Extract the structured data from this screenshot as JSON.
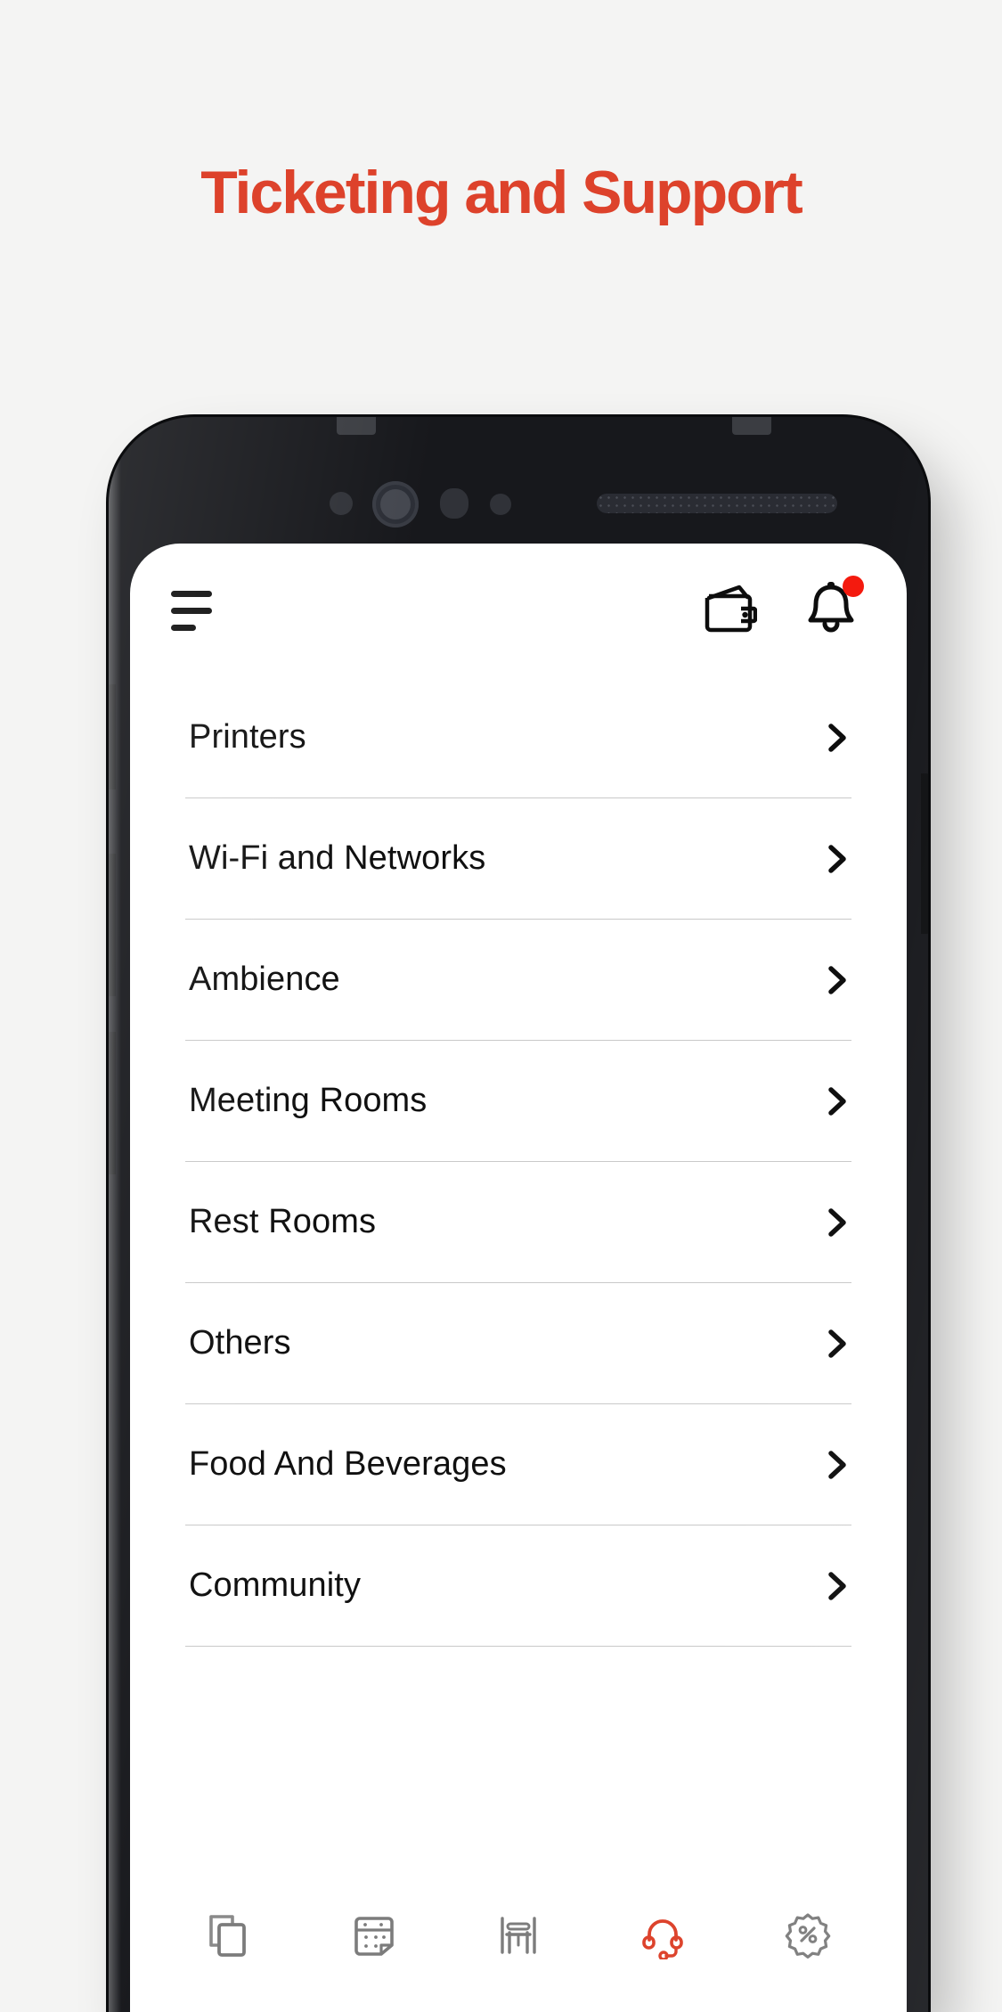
{
  "page": {
    "title": "Ticketing and Support",
    "title_color": "#dd422b",
    "background_color": "#f4f4f3"
  },
  "app": {
    "header": {
      "menu_icon": "hamburger-menu-icon",
      "wallet_icon": "wallet-icon",
      "notifications_icon": "bell-icon",
      "notification_badge_color": "#f41a0e",
      "has_notification": true
    },
    "list": {
      "chevron_icon": "chevron-right-icon",
      "items": [
        {
          "label": "Printers"
        },
        {
          "label": "Wi-Fi and Networks"
        },
        {
          "label": "Ambience"
        },
        {
          "label": "Meeting Rooms"
        },
        {
          "label": "Rest Rooms"
        },
        {
          "label": "Others"
        },
        {
          "label": "Food And Beverages"
        },
        {
          "label": "Community"
        }
      ]
    },
    "bottom_nav": {
      "active_color": "#dd422b",
      "inactive_color": "#7c7c7c",
      "items": [
        {
          "name": "pages-icon",
          "active": false
        },
        {
          "name": "booking-calendar-icon",
          "active": false
        },
        {
          "name": "desk-icon",
          "active": false
        },
        {
          "name": "support-headset-icon",
          "active": true
        },
        {
          "name": "offers-badge-icon",
          "active": false
        }
      ]
    }
  }
}
